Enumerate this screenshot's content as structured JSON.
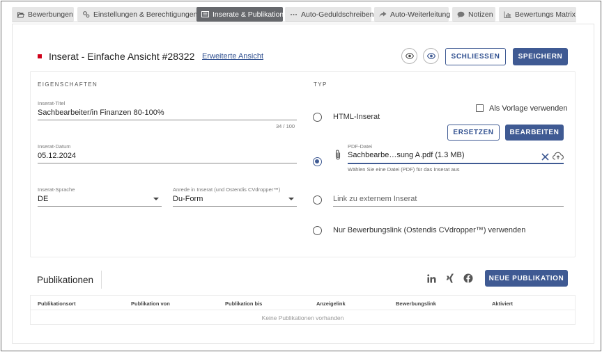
{
  "tabs": [
    {
      "label": "Bewerbungen",
      "icon": "folder-open-icon",
      "active": false
    },
    {
      "label": "Einstellungen & Berechtigungen",
      "icon": "gears-icon",
      "active": false
    },
    {
      "label": "Inserate & Publikation",
      "icon": "newspaper-icon",
      "active": true
    },
    {
      "label": "Auto-Geduldschreiben",
      "icon": "ellipsis-icon",
      "active": false
    },
    {
      "label": "Auto-Weiterleitung",
      "icon": "forward-icon",
      "active": false
    },
    {
      "label": "Notizen",
      "icon": "comment-icon",
      "active": false
    },
    {
      "label": "Bewertungs Matrix",
      "icon": "bar-chart-icon",
      "active": false
    }
  ],
  "header": {
    "title": "Inserat - Einfache Ansicht #28322",
    "extended_view_link": "Erweiterte Ansicht",
    "close_label": "SCHLIESSEN",
    "save_label": "SPEICHERN",
    "accent_color": "#d0021b"
  },
  "properties": {
    "heading": "EIGENSCHAFTEN",
    "title_field": {
      "label": "Inserat-Titel",
      "value": "Sachbearbeiter/in Finanzen 80-100%",
      "counter": "34 / 100"
    },
    "date_field": {
      "label": "Inserat-Datum",
      "value": "05.12.2024"
    },
    "language_field": {
      "label": "Inserat-Sprache",
      "value": "DE"
    },
    "salutation_field": {
      "label": "Anrede in Inserat (und Ostendis CVdropper™)",
      "value": "Du-Form"
    }
  },
  "type": {
    "heading": "TYP",
    "html_option": "HTML-Inserat",
    "template_checkbox": "Als Vorlage verwenden",
    "replace_label": "ERSETZEN",
    "edit_label": "BEARBEITEN",
    "pdf_label": "PDF-Datei",
    "pdf_value": "Sachbearbe…sung A.pdf (1.3 MB)",
    "pdf_hint": "Wählen Sie eine Datei (PDF) für das Inserat aus",
    "link_placeholder": "Link zu externem Inserat",
    "apply_link_option": "Nur Bewerbungslink (Ostendis CVdropper™) verwenden",
    "selected": "pdf"
  },
  "publications": {
    "title": "Publikationen",
    "new_label": "NEUE PUBLIKATION",
    "columns": [
      "Publikationsort",
      "Publikation von",
      "Publikation bis",
      "Anzeigelink",
      "Bewerbungslink",
      "Aktiviert"
    ],
    "empty_text": "Keine Publikationen vorhanden"
  },
  "colors": {
    "primary": "#3f5a93",
    "tab_active": "#66686c",
    "tab_inactive": "#e6e6e6"
  }
}
